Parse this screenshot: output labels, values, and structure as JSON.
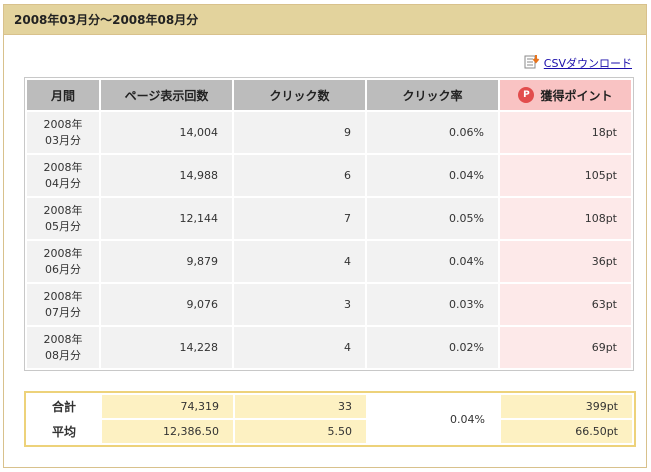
{
  "header": {
    "title": "2008年03月分～2008年08月分"
  },
  "csv": {
    "label": "CSVダウンロード",
    "icon": "document-download-icon"
  },
  "table": {
    "columns": [
      "月間",
      "ページ表示回数",
      "クリック数",
      "クリック率",
      "獲得ポイント"
    ],
    "points_icon_letter": "P",
    "rows": [
      {
        "year": "2008年",
        "month": "03月分",
        "views": "14,004",
        "clicks": "9",
        "rate": "0.06%",
        "points": "18pt"
      },
      {
        "year": "2008年",
        "month": "04月分",
        "views": "14,988",
        "clicks": "6",
        "rate": "0.04%",
        "points": "105pt"
      },
      {
        "year": "2008年",
        "month": "05月分",
        "views": "12,144",
        "clicks": "7",
        "rate": "0.05%",
        "points": "108pt"
      },
      {
        "year": "2008年",
        "month": "06月分",
        "views": "9,879",
        "clicks": "4",
        "rate": "0.04%",
        "points": "36pt"
      },
      {
        "year": "2008年",
        "month": "07月分",
        "views": "9,076",
        "clicks": "3",
        "rate": "0.03%",
        "points": "63pt"
      },
      {
        "year": "2008年",
        "month": "08月分",
        "views": "14,228",
        "clicks": "4",
        "rate": "0.02%",
        "points": "69pt"
      }
    ]
  },
  "summary": {
    "total": {
      "label": "合計",
      "views": "74,319",
      "clicks": "33",
      "points": "399pt"
    },
    "average": {
      "label": "平均",
      "views": "12,386.50",
      "clicks": "5.50",
      "points": "66.50pt"
    },
    "rate": "0.04%"
  },
  "colors": {
    "header_bg": "#e3d39d",
    "table_header_bg": "#bcbcbc",
    "points_header_bg": "#f9c3c3",
    "points_cell_bg": "#fde9e9",
    "summary_border": "#edd27a",
    "summary_cell_bg": "#fdf1c2",
    "link": "#1a0dab"
  }
}
